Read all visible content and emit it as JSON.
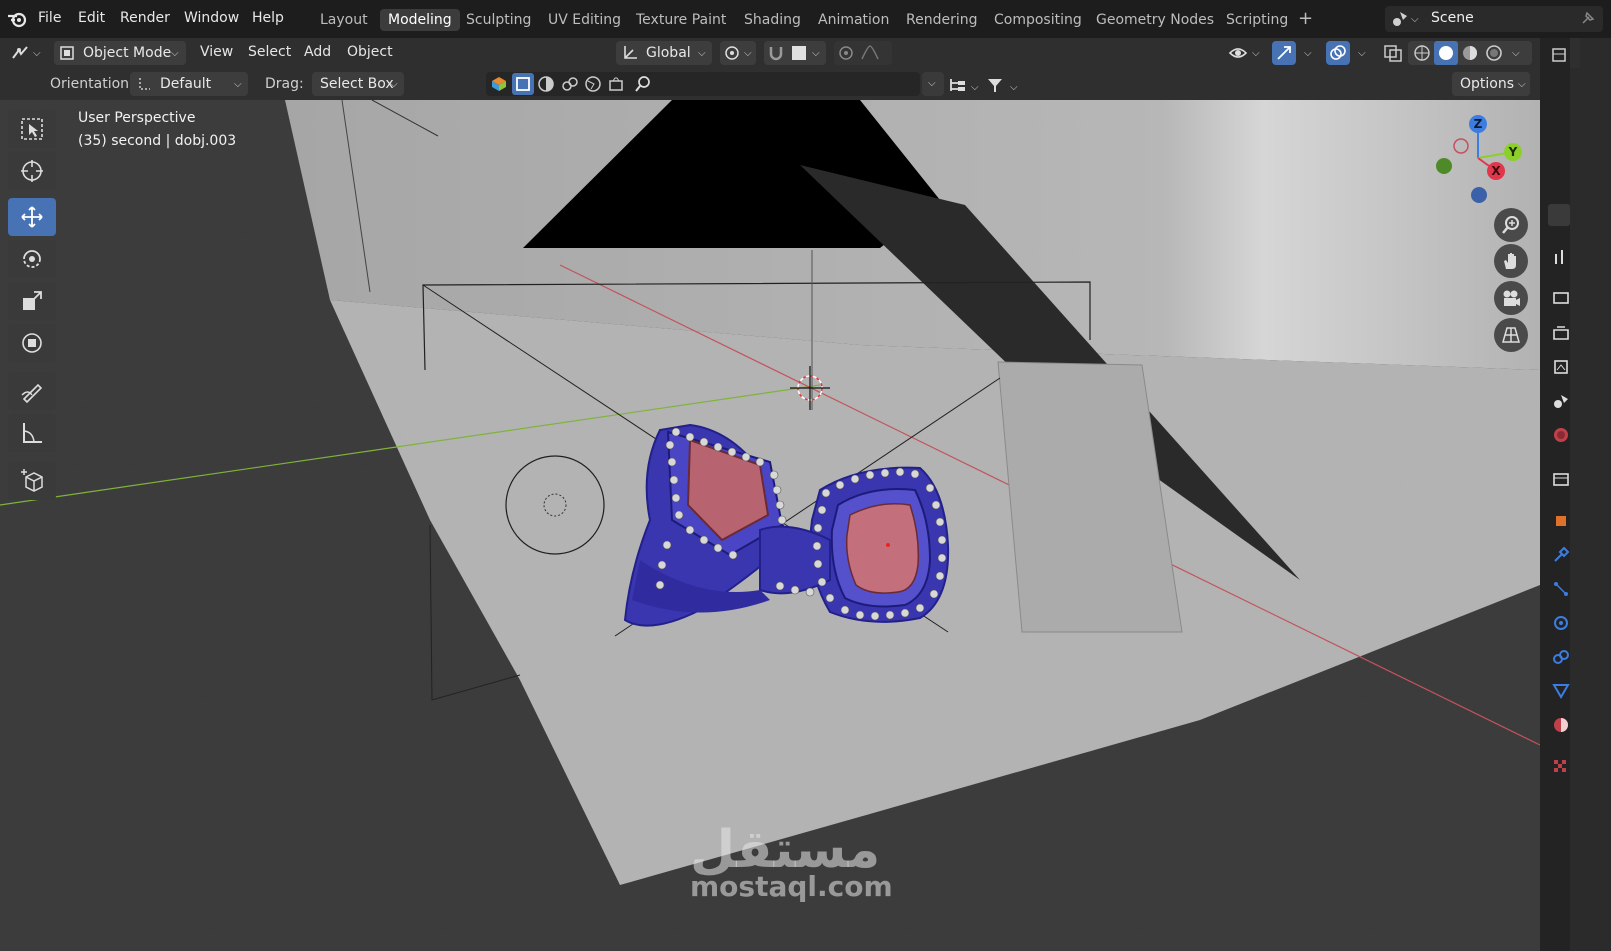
{
  "topbar": {
    "menus": [
      "File",
      "Edit",
      "Render",
      "Window",
      "Help"
    ],
    "workspaces": [
      "Layout",
      "Modeling",
      "Sculpting",
      "UV Editing",
      "Texture Paint",
      "Shading",
      "Animation",
      "Rendering",
      "Compositing",
      "Geometry Nodes",
      "Scripting"
    ],
    "active_workspace": "Modeling",
    "scene_name": "Scene"
  },
  "header": {
    "mode": "Object Mode",
    "menus": [
      "View",
      "Select",
      "Add",
      "Object"
    ],
    "transform_orientation": "Global",
    "orientation_label": "Orientation:",
    "orientation_value": "Default",
    "drag_label": "Drag:",
    "drag_value": "Select Box",
    "options_label": "Options"
  },
  "viewport": {
    "view_name": "User Perspective",
    "context_line": "(35) second | dobj.003",
    "gizmo_axes": [
      "Z",
      "Y",
      "X"
    ]
  },
  "watermark": {
    "arabic": "مستقل",
    "url": "mostaql.com"
  },
  "colors": {
    "accent": "#4772b3",
    "ring_metal": "#3a36b0",
    "gem": "#b86470",
    "axis_x": "#e2364a",
    "axis_y": "#8ccf2a",
    "axis_z": "#3b7de0"
  },
  "icons": [
    "blender-logo-icon",
    "select-box-tool-icon",
    "cursor-tool-icon",
    "move-tool-icon",
    "rotate-tool-icon",
    "scale-tool-icon",
    "transform-tool-icon",
    "annotate-tool-icon",
    "measure-tool-icon",
    "add-cube-tool-icon",
    "zoom-icon",
    "hand-pan-icon",
    "camera-icon",
    "grid-perspective-icon"
  ]
}
